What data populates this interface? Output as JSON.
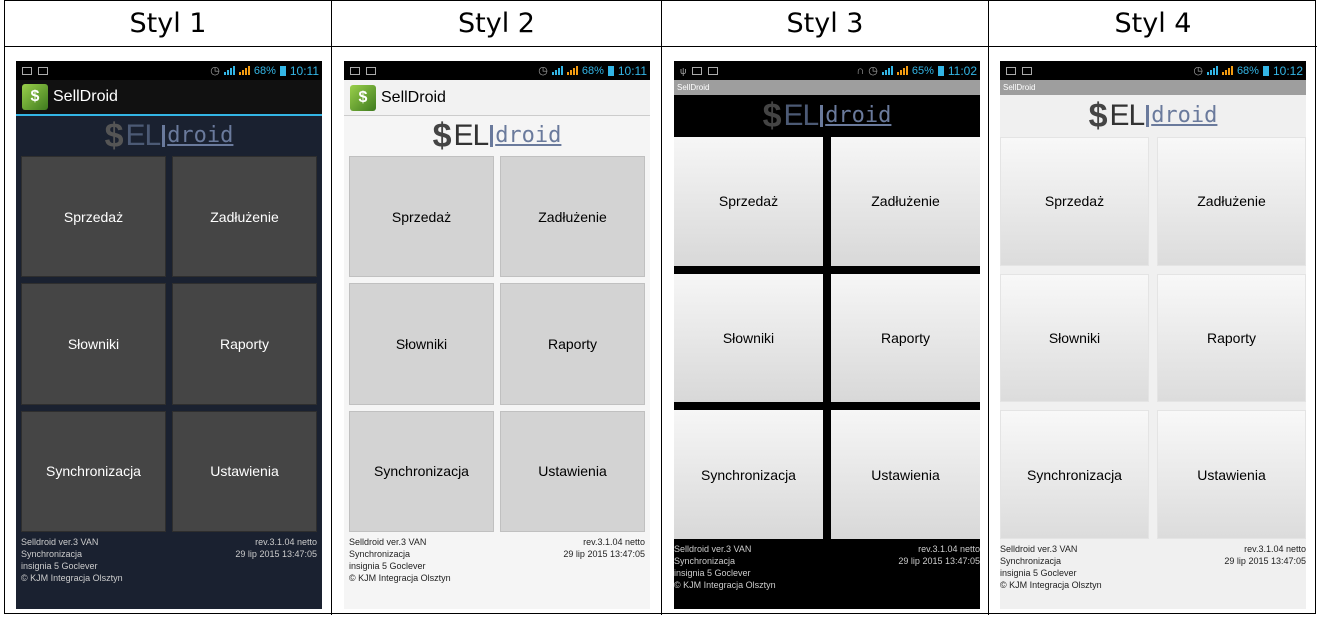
{
  "headers": [
    "Styl 1",
    "Styl 2",
    "Styl 3",
    "Styl 4"
  ],
  "status": [
    {
      "battery": "68%",
      "time": "10:11"
    },
    {
      "battery": "68%",
      "time": "10:11"
    },
    {
      "battery": "65%",
      "time": "11:02"
    },
    {
      "battery": "68%",
      "time": "10:12"
    }
  ],
  "app": {
    "title": "SellDroid",
    "logo_prefix": "EL",
    "logo_suffix": "droid"
  },
  "tiles": {
    "sales": "Sprzedaż",
    "debt": "Zadłużenie",
    "dictionaries": "Słowniki",
    "reports": "Raporty",
    "sync": "Synchronizacja",
    "settings": "Ustawienia"
  },
  "footer": {
    "version": "Selldroid ver.3 VAN",
    "revision": "rev.3.1.04 netto",
    "sync_label": "Synchronizacja",
    "sync_date": "29 lip 2015 13:47:05",
    "device": "insignia 5 Goclever",
    "copyright": "© KJM Integracja Olsztyn"
  },
  "colors": {
    "accent": "#33b5e5",
    "dark_tile": "#454545",
    "light_tile": "#d3d3d3"
  }
}
